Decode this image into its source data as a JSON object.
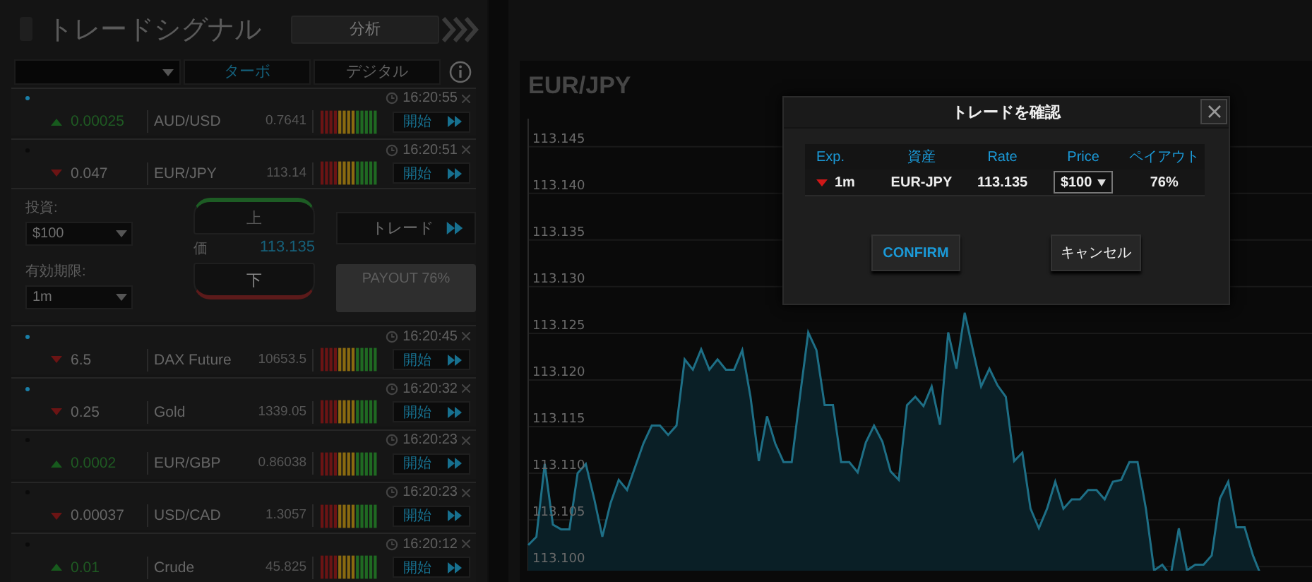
{
  "sidebar": {
    "title": "トレードシグナル",
    "analysis_button": "分析",
    "filter": {
      "tabs": [
        {
          "label": "ターボ",
          "selected": true
        },
        {
          "label": "デジタル",
          "selected": false
        }
      ]
    },
    "signals": [
      {
        "color": "#1a7fa8",
        "time": "16:20:55",
        "rising": true,
        "change": "0.00025",
        "asset": "AUD/USD",
        "price": "0.7641",
        "start": "開始"
      },
      {
        "color": "#0a0a0a",
        "time": "16:20:51",
        "rising": false,
        "change": "0.047",
        "asset": "EUR/JPY",
        "price": "113.14",
        "start": "開始",
        "detail": {
          "invest_label": "投資:",
          "invest_value": "$100",
          "expiry_label": "有効期限:",
          "expiry_value": "1m",
          "up": "上",
          "down": "下",
          "rate_label": "価",
          "rate": "113.135",
          "trade": "トレード",
          "payout": "PAYOUT 76%"
        }
      },
      {
        "color": "#1a7fa8",
        "time": "16:20:45",
        "rising": false,
        "change": "6.5",
        "asset": "DAX Future",
        "price": "10653.5",
        "start": "開始"
      },
      {
        "color": "#1a7fa8",
        "time": "16:20:32",
        "rising": false,
        "change": "0.25",
        "asset": "Gold",
        "price": "1339.05",
        "start": "開始"
      },
      {
        "color": "#0a0a0a",
        "time": "16:20:23",
        "rising": true,
        "change": "0.0002",
        "asset": "EUR/GBP",
        "price": "0.86038",
        "start": "開始"
      },
      {
        "color": "#0a0a0a",
        "time": "16:20:23",
        "rising": false,
        "change": "0.00037",
        "asset": "USD/CAD",
        "price": "1.3057",
        "start": "開始"
      },
      {
        "color": "#0a0a0a",
        "time": "16:20:12",
        "rising": true,
        "change": "0.01",
        "asset": "Crude",
        "price": "45.825",
        "start": "開始"
      }
    ]
  },
  "chart": {
    "chart_data": {
      "type": "area",
      "title": "EUR/JPY",
      "grid": true,
      "ylim": [
        113.0985,
        113.148
      ],
      "yticks": [
        {
          "value": 113.1,
          "label": "113.100"
        },
        {
          "value": 113.105,
          "label": "113.105"
        },
        {
          "value": 113.11,
          "label": "113.110"
        },
        {
          "value": 113.115,
          "label": "113.115"
        },
        {
          "value": 113.12,
          "label": "113.120"
        },
        {
          "value": 113.125,
          "label": "113.125"
        },
        {
          "value": 113.13,
          "label": "113.130"
        },
        {
          "value": 113.135,
          "label": "113.135"
        },
        {
          "value": 113.14,
          "label": "113.140"
        },
        {
          "value": 113.145,
          "label": "113.145"
        }
      ],
      "series": [
        {
          "color": "#1e6f86",
          "values": [
            113.1023,
            113.1032,
            113.111,
            113.1045,
            113.104,
            113.104,
            113.11,
            113.111,
            113.1073,
            113.1032,
            113.1068,
            113.1093,
            113.1082,
            113.1107,
            113.1132,
            113.1151,
            113.1151,
            113.1141,
            113.1151,
            113.1222,
            113.1211,
            113.1233,
            113.1211,
            113.1222,
            113.1211,
            113.1211,
            113.1232,
            113.1182,
            113.1113,
            113.1161,
            113.1132,
            113.1112,
            113.1112,
            113.1182,
            113.1251,
            113.1232,
            113.1173,
            113.1173,
            113.1112,
            113.1112,
            113.1101,
            113.1133,
            113.1151,
            113.1134,
            113.1102,
            113.1093,
            113.1173,
            113.1182,
            113.1172,
            113.1193,
            113.1152,
            113.1251,
            113.1212,
            113.1272,
            113.1232,
            113.1193,
            113.1212,
            113.1194,
            113.1182,
            113.1113,
            113.1122,
            113.1062,
            113.1041,
            113.1062,
            113.1091,
            113.1062,
            113.1072,
            113.1072,
            113.1082,
            113.1082,
            113.1072,
            113.1091,
            113.1093,
            113.1112,
            113.1112,
            113.1062,
            113.0996,
            113.1002,
            113.099,
            113.1041,
            113.0996,
            113.1002,
            113.1002,
            113.1012,
            113.1073,
            113.1091,
            113.1042,
            113.1042,
            113.1012,
            113.099
          ]
        }
      ]
    }
  },
  "dialog": {
    "title": "トレードを確認",
    "columns": [
      "Exp.",
      "資産",
      "Rate",
      "Price",
      "ペイアウト"
    ],
    "row": {
      "rising": false,
      "expiry": "1m",
      "asset": "EUR-JPY",
      "rate": "113.135",
      "price": "$100",
      "payout": "76%"
    },
    "confirm": "CONFIRM",
    "cancel": "キャンセル"
  }
}
